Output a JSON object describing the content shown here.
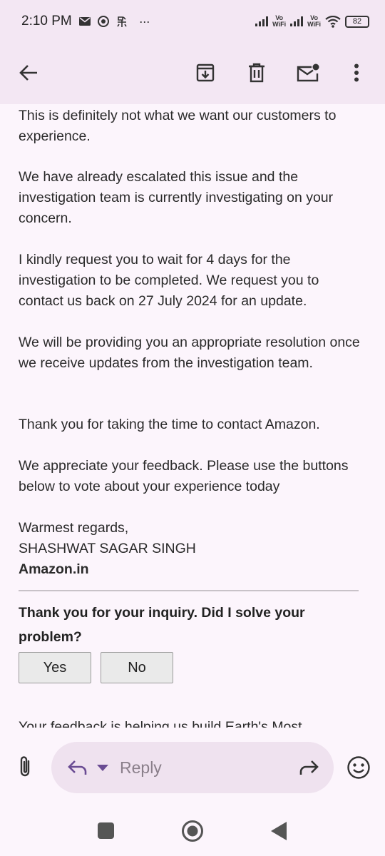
{
  "status_bar": {
    "time": "2:10 PM",
    "left_icons": [
      "mail-icon",
      "chrome-icon",
      "app-icon",
      "more-dots-icon"
    ],
    "more": "···",
    "vowifi_label_1": "Vo",
    "vowifi_label_2": "WiFi",
    "battery": "82"
  },
  "toolbar": {
    "icons": [
      "back-arrow-icon",
      "archive-icon",
      "delete-icon",
      "mark-unread-icon",
      "more-vert-icon"
    ]
  },
  "email": {
    "paragraphs": [
      "This is definitely not what we want our customers to experience.",
      "We have already escalated this issue and the investigation team is currently investigating on your concern.",
      "I kindly request you to wait for 4 days for the investigation to be completed. We request you to contact us back on 27 July 2024 for an update.",
      "We will be providing you an appropriate resolution once we receive updates from the investigation team.",
      "Thank you for taking the time to contact Amazon.",
      "We appreciate your feedback. Please use the buttons below to vote about your experience today"
    ],
    "closing": "Warmest regards,",
    "signer": "SHASHWAT SAGAR SINGH",
    "company": "Amazon.in",
    "question": "Thank you for your inquiry. Did I solve your problem?",
    "yes_label": "Yes",
    "no_label": "No",
    "cut_off_text": "Your feedback is helping us build Earth's Most"
  },
  "compose": {
    "reply_placeholder": "Reply"
  },
  "colors": {
    "bar_bg": "#f3e7f3",
    "page_bg": "#fcf5fc",
    "accent": "#6a4c93"
  }
}
